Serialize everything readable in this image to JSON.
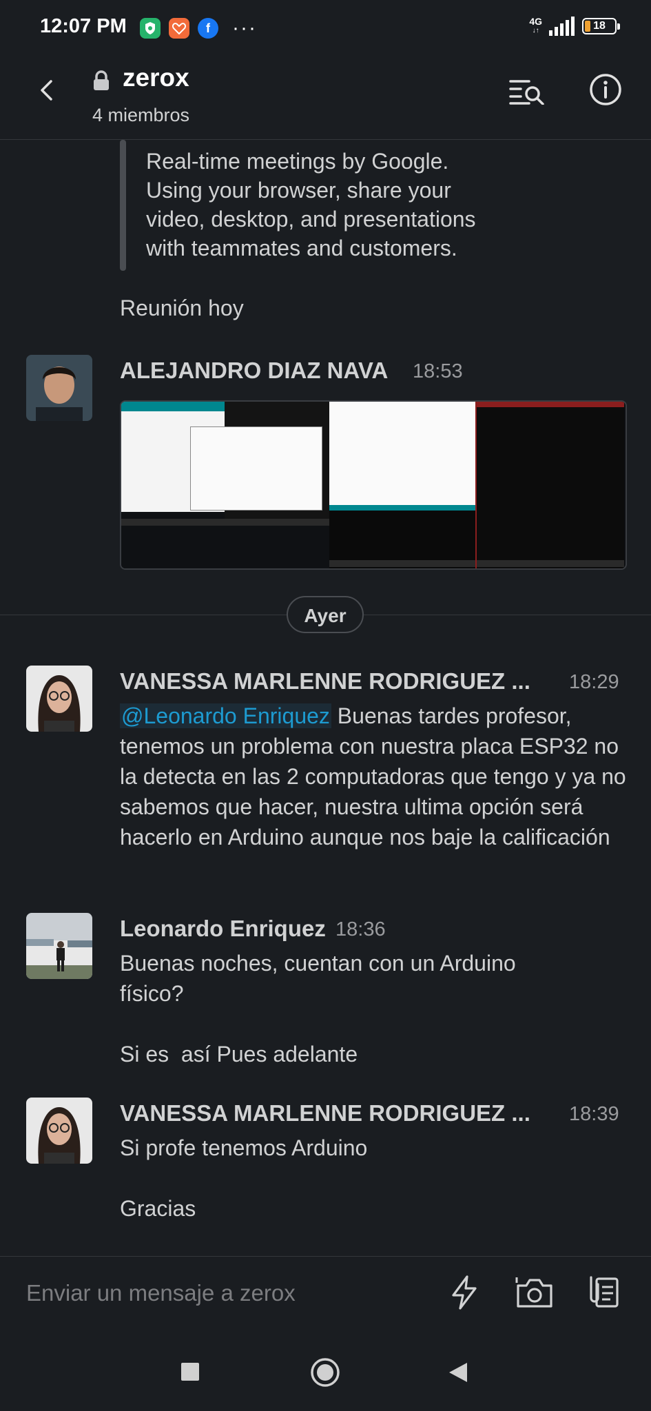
{
  "status_bar": {
    "time": "12:07 PM",
    "network": "4G",
    "battery": "18",
    "battery_level": 0.18,
    "overflow": "···"
  },
  "header": {
    "channel_name": "zerox",
    "members": "4 miembros"
  },
  "quote": {
    "lines": [
      "Real-time meetings by Google.",
      "Using your browser, share your",
      "video, desktop, and presentations",
      "with teammates and customers."
    ]
  },
  "messages": [
    {
      "author": "",
      "time": "",
      "text": "Reunión hoy"
    },
    {
      "author": "ALEJANDRO DIAZ NAVA",
      "time": "18:53",
      "text": ""
    },
    {
      "author": "VANESSA MARLENNE RODRIGUEZ ...",
      "time": "18:29",
      "mention": "@Leonardo Enriquez",
      "text": " Buenas tardes profesor, tenemos un problema con nuestra placa ESP32 no la detecta en las 2 computadoras que tengo y ya no sabemos que hacer, nuestra ultima opción será hacerlo en Arduino aunque nos baje la calificación"
    },
    {
      "author": "Leonardo Enriquez",
      "time": "18:36",
      "lines": [
        "Buenas noches, cuentan con un Arduino",
        "físico?",
        "",
        "Si es  así Pues adelante"
      ]
    },
    {
      "author": "VANESSA MARLENNE RODRIGUEZ ...",
      "time": "18:39",
      "lines": [
        "Si profe tenemos Arduino",
        "",
        "Gracias"
      ]
    }
  ],
  "day_divider": "Ayer",
  "composer": {
    "placeholder": "Enviar un mensaje a zerox"
  },
  "colors": {
    "background": "#1a1d21",
    "mention": "#1d9bd1",
    "battery": "#f0a232"
  }
}
